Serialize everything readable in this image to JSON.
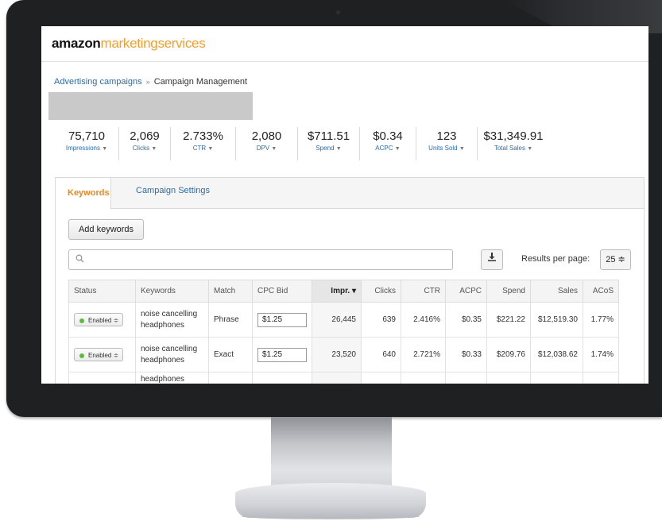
{
  "header": {
    "logo_bold": "amazon",
    "logo_rest": "marketingservices"
  },
  "breadcrumb": {
    "parent": "Advertising campaigns",
    "separator": "»",
    "current": "Campaign Management"
  },
  "metrics": [
    {
      "value": "75,710",
      "label": "Impressions"
    },
    {
      "value": "2,069",
      "label": "Clicks"
    },
    {
      "value": "2.733%",
      "label": "CTR"
    },
    {
      "value": "2,080",
      "label": "DPV"
    },
    {
      "value": "$711.51",
      "label": "Spend"
    },
    {
      "value": "$0.34",
      "label": "ACPC"
    },
    {
      "value": "123",
      "label": "Units Sold"
    },
    {
      "value": "$31,349.91",
      "label": "Total Sales"
    }
  ],
  "tabs": {
    "keywords": "Keywords",
    "settings": "Campaign Settings"
  },
  "toolbar": {
    "add_keywords": "Add keywords",
    "search_placeholder": "",
    "results_per_page_label": "Results per page:",
    "results_per_page_value": "25 ≑",
    "download_icon": "download-icon",
    "search_icon": "search-icon"
  },
  "table": {
    "columns": [
      "Status",
      "Keywords",
      "Match",
      "CPC Bid",
      "Impr. ▾",
      "Clicks",
      "CTR",
      "ACPC",
      "Spend",
      "Sales",
      "ACoS"
    ],
    "rows": [
      {
        "status": "Enabled ≑",
        "keyword_line1": "noise cancelling",
        "keyword_line2": "headphones",
        "match": "Phrase",
        "bid": "$1.25",
        "impr": "26,445",
        "clicks": "639",
        "ctr": "2.416%",
        "acpc": "$0.35",
        "spend": "$221.22",
        "sales": "$12,519.30",
        "acos": "1.77%"
      },
      {
        "status": "Enabled ≑",
        "keyword_line1": "noise cancelling",
        "keyword_line2": "headphones",
        "match": "Exact",
        "bid": "$1.25",
        "impr": "23,520",
        "clicks": "640",
        "ctr": "2.721%",
        "acpc": "$0.33",
        "spend": "$209.76",
        "sales": "$12,038.62",
        "acos": "1.74%"
      },
      {
        "status": "",
        "keyword_line1": "headphones",
        "keyword_line2": "",
        "match": "",
        "bid": "",
        "impr": "",
        "clicks": "",
        "ctr": "",
        "acpc": "",
        "spend": "",
        "sales": "",
        "acos": ""
      }
    ]
  },
  "colors": {
    "brand_orange": "#f0a02e",
    "link_blue": "#2d6ca5",
    "active_tab": "#e08a2a",
    "enabled_dot": "#5cbb3b"
  }
}
